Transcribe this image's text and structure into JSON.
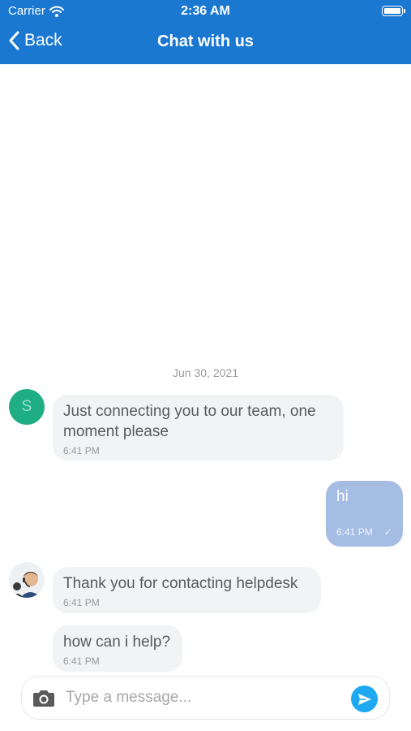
{
  "status_bar": {
    "carrier": "Carrier",
    "time": "2:36 AM"
  },
  "nav": {
    "back_label": "Back",
    "title": "Chat with us"
  },
  "conversation": {
    "date": "Jun 30, 2021",
    "bot_avatar_letter": "S",
    "messages": [
      {
        "direction": "in",
        "text": "Just connecting you to our team, one moment please",
        "time": "6:41 PM"
      },
      {
        "direction": "out",
        "text": "hi",
        "time": "6:41 PM",
        "status_icon": "✓"
      },
      {
        "direction": "in",
        "text": "Thank you for contacting helpdesk",
        "time": "6:41 PM"
      },
      {
        "direction": "in",
        "text": "how can i help?",
        "time": "6:41 PM"
      }
    ]
  },
  "composer": {
    "placeholder": "Type a message...",
    "value": ""
  },
  "icons": {
    "wifi": "wifi-icon",
    "battery": "battery-icon",
    "back": "chevron-left-icon",
    "camera": "camera-icon",
    "send": "send-icon",
    "check": "check-icon"
  },
  "colors": {
    "header": "#1a78d1",
    "avatar_bot": "#1fae84",
    "bubble_in": "#f2f3f5",
    "bubble_out": "#a6bde3",
    "send_button": "#1ea8f0"
  }
}
